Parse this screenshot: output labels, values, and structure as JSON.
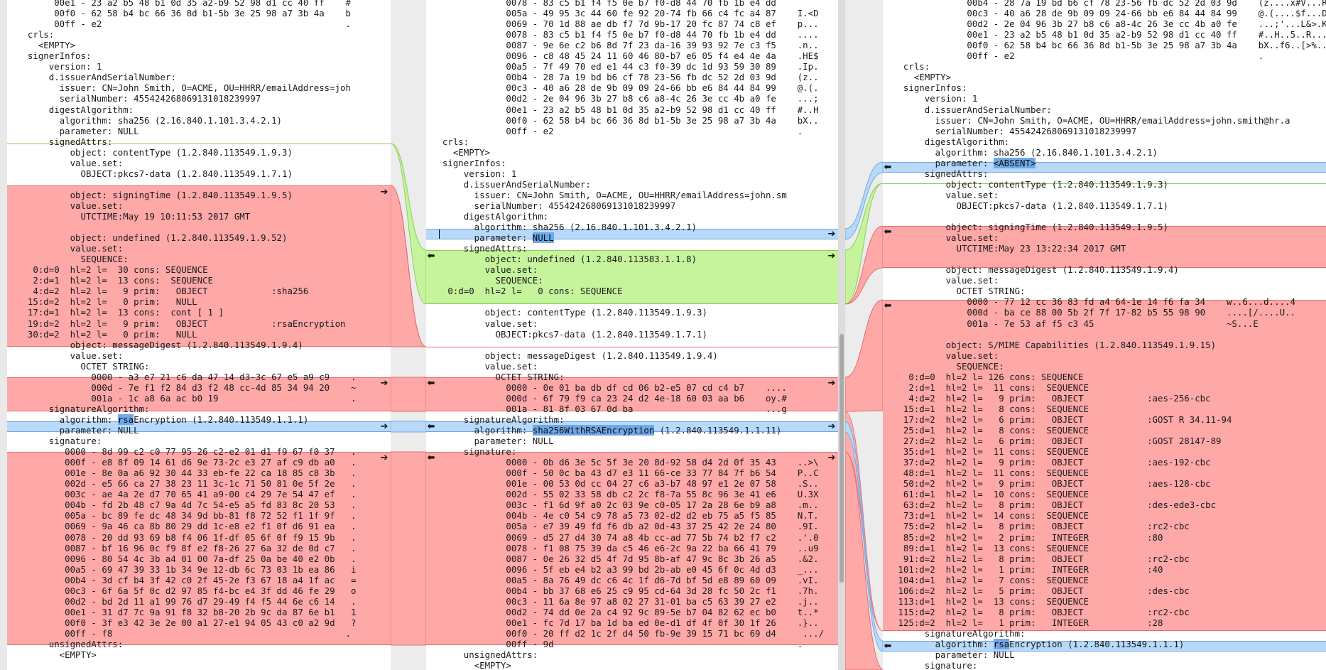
{
  "colors": {
    "deleted": "#ffa8a8",
    "inserted": "#c6f49c",
    "changed": "#b8d9fa",
    "token_highlight": "#6fa8e8"
  },
  "icons": {
    "merge_right": "arrow-right-icon",
    "merge_left": "arrow-left-icon"
  },
  "panes": [
    {
      "lines": [
        "       00e1 - 23 a2 b5 48 b1 0d 35 a2-b9 52 98 d1 cc 40 ff    #",
        "       00f0 - 62 58 b4 bc 66 36 8d b1-5b 3e 25 98 a7 3b 4a    b",
        "       00ff - e2                                              .",
        "  crls:",
        "    <EMPTY>",
        "  signerInfos:",
        "      version: 1",
        "      d.issuerAndSerialNumber:",
        "        issuer: CN=John Smith, O=ACME, OU=HHRR/emailAddress=joh",
        "        serialNumber: 4554242680691310182399​97",
        "      digestAlgorithm:",
        "        algorithm: sha256 (2.16.840.1.101.3.4.2.1)",
        "        parameter: NULL",
        "      signedAttrs:",
        "          object: contentType (1.2.840.113549.1.9.3)",
        "          value.set:",
        "            OBJECT:pkcs7-data (1.2.840.113549.1.7.1)",
        "",
        "          object: signingTime (1.2.840.113549.1.9.5)",
        "          value.set:",
        "            UTCTIME:May 19 10:11:53 2017 GMT",
        "",
        "          object: undefined (1.2.840.113549.1.9.52)",
        "          value.set:",
        "            SEQUENCE:",
        "   0:d=0  hl=2 l=  30 cons: SEQUENCE",
        "   2:d=1  hl=2 l=  13 cons:  SEQUENCE",
        "   4:d=2  hl=2 l=   9 prim:   OBJECT            :sha256",
        "  15:d=2  hl=2 l=   0 prim:   NULL",
        "  17:d=1  hl=2 l=  13 cons:  cont [ 1 ]",
        "  19:d=2  hl=2 l=   9 prim:   OBJECT            :rsaEncryption",
        "  30:d=2  hl=2 l=   0 prim:   NULL",
        "          object: messageDigest (1.2.840.113549.1.9.4)",
        "          value.set:",
        "            OCTET STRING:",
        "              0000 - a3 e7 21 c6 da 47 14 d3-3c 67 e5 a9 c9    .",
        "              000d - 7e f1 f2 84 d3 f2 48 cc-4d 85 34 94 20    ~",
        "              001a - 1c a8 6a ac b0 19                         .",
        "      signatureAlgorithm:",
        "        algorithm: rsaEncryption (1.2.840.113549.1.1.1)",
        "        parameter: NULL",
        "      signature:",
        "         0000 - 8d 99 c2 c0 77 95 26 c2-e2 01 d1 f9 67 f0 37   .",
        "         000f - e8 8f 09 14 61 d6 9e 73-2c e3 27 af c9 db a0   .",
        "         001e - 8e 0a a6 92 30 44 33 eb-fe 22 ca 18 85 c8 3b   .",
        "         002d - e5 66 ca 27 38 23 11 3c-1c 71 50 81 0e 5f 2e   .",
        "         003c - ae 4a 2e d7 70 65 41 a9-00 c4 29 7e 54 47 ef   .",
        "         004b - fd 2b 48 c7 9a 4d 7c 54-e5 a5 fd 83 8c 20 53   .",
        "         005a - bc 89 fe dc 48 34 9d bb-81 f8 72 52 f1 1f 9f   .",
        "         0069 - 9a 46 ca 8b 80 29 dd 1c-e8 e2 f1 0f d6 91 ea   .",
        "         0078 - 20 dd 93 69 b8 f4 06 1f-df 05 6f 0f f9 15 9b   .",
        "         0087 - bf 16 96 0c f9 8f e2 f8-26 27 6a 32 de 0d c7   .",
        "         0096 - 80 54 4c 3b a4 01 00 7a-df 25 0a be 40 e2 0b   .",
        "         00a5 - 69 47 39 33 1b 34 9e 12-db 6c 73 03 1b ea 86   i",
        "         00b4 - 3d cf b4 3f 42 c0 2f 45-2e f3 67 18 a4 1f ac   =",
        "         00c3 - 6f 6a 5f 0c d2 97 85 f4-bc e4 3f dd 46 fe 29   o",
        "         00d2 - bd 2d 11 a1 99 76 d7 29-49 f4 f5 44 6e c6 14   .",
        "         00e1 - 31 d7 7c 9a 91 f8 32 b8-20 2b 9c da 87 6e b1   1",
        "         00f0 - 3f e3 42 3e 2e 00 a1 27-e1 94 05 43 c0 a2 9d   ?",
        "         00ff - f8                                            .",
        "      unsignedAttrs:",
        "        <EMPTY>"
      ]
    },
    {
      "lines": [
        "              0078 - 83 c5 b1 f4 f5 0e b7 f0-d8 44 70 fb 1b e4 dd",
        "              005a - 49 95 3c 44 60 fe 92 20-74 fb 66 c4 fc a4 87    I.<D",
        "              0069 - 70 1d 88 ae db f7 7d 9b-17 20 fc 87 74 c8 ef    p...",
        "              0078 - 83 c5 b1 f4 f5 0e b7 f0-d8 44 70 fb 1b e4 dd    ....",
        "              0087 - 9e 6e c2 b6 8d 7f 23 da-16 39 93 92 7e c3 f5    .n..",
        "              0096 - c8 48 45 24 11 60 46 80-b7 e6 05 f4 e4 4e 4a    .HE$",
        "              00a5 - 7f 49 70 ed e1 44 c3 f0-39 dc 1d 93 59 30 89    .Ip.",
        "              00b4 - 28 7a 19 bd b6 cf 78 23-56 fb dc 52 2d 03 9d    (z..",
        "              00c3 - 40 a6 28 de 9b 09 09 24-66 bb e6 84 44 84 99    @.(.",
        "              00d2 - 2e 04 96 3b 27 b8 c6 a8-4c 26 3e cc 4b a0 fe    ...;",
        "              00e1 - 23 a2 b5 48 b1 0d 35 a2-b9 52 98 d1 cc 40 ff    #..H",
        "              00f0 - 62 58 b4 bc 66 36 8d b1-5b 3e 25 98 a7 3b 4a    bX..",
        "              00ff - e2                                              .",
        "  crls:",
        "    <EMPTY>",
        "  signerInfos:",
        "      version: 1",
        "      d.issuerAndSerialNumber:",
        "        issuer: CN=John Smith, O=ACME, OU=HHRR/emailAddress=john.sm",
        "        serialNumber: 4554242680691310182399​97",
        "      digestAlgorithm:",
        "        algorithm: sha256 (2.16.840.1.101.3.4.2.1)",
        "        parameter: NULL",
        "      signedAttrs:",
        "          object: undefined (1.2.840.113583.1.1.8)",
        "          value.set:",
        "            SEQUENCE:",
        "   0:d=0  hl=2 l=   0 cons: SEQUENCE",
        "",
        "          object: contentType (1.2.840.113549.1.9.3)",
        "          value.set:",
        "            OBJECT:pkcs7-data (1.2.840.113549.1.7.1)",
        "",
        "          object: messageDigest (1.2.840.113549.1.9.4)",
        "          value.set:",
        "            OCTET STRING:",
        "              0000 - 0e 01 ba db df cd 06 b2-e5 07 cd c4 b7    ....",
        "              000d - 6f 79 f9 ca 23 24 d2 4e-18 60 03 aa b6    oy.#",
        "              001a - 81 8f 03 67 0d ba                         ...g",
        "      signatureAlgorithm:",
        "        algorithm: sha256WithRSAEncryption (1.2.840.113549.1.1.11)",
        "        parameter: NULL",
        "      signature:",
        "              0000 - 0b d6 3e 5c 5f 3e 20 8d-92 58 d4 2d 0f 35 43    ..>\\",
        "              000f - 50 0c ba 43 d7 e3 11 66-ce 33 77 84 7f b6 54    P..C",
        "              001e - 00 53 0d cc 04 27 c6 a3-b7 48 97 e1 2e 07 58    .S..",
        "              002d - 55 02 33 58 db c2 2c f8-7a 55 8c 96 3e 41 e6    U.3X",
        "              003c - f1 6d 9f a0 2c 03 9e c0-05 17 2a 28 6e b9 a8    .m..",
        "              004b - 4e c0 54 c9 78 a5 73 02-d2 d2 eb 75 a5 f5 85    N.T.",
        "              005a - e7 39 49 fd f6 db a2 0d-43 37 25 42 2e 24 80    .9I.",
        "              0069 - d5 27 d4 30 74 a8 4b cc-ad 77 5b 74 b2 f7 c2    .'.0",
        "              0078 - f1 08 75 39 da c5 46 e6-2c 9a 22 ba 66 41 79    ..u9",
        "              0087 - 0e 26 32 d5 4f 7d 95 8b-af 47 9c 8c 3b 26 a5    .&2.",
        "              0096 - 5f eb e4 b2 a3 99 bd 2b-ab e0 45 6f 0c 4d d3    _...",
        "              00a5 - 8a 76 49 dc c6 4c 1f d6-7d bf 5d e8 89 60 09    .vI.",
        "              00b4 - bb 37 68 e6 25 c9 95 cd-64 3d 28 fc 50 2c f1    .7h.",
        "              00c3 - 11 6a 8e 97 a8 02 27 31-01 ba c5 63 39 27 e2    .j..",
        "              00d2 - 74 dd 0e 2a c4 92 9c 89-5e b7 04 82 62 ec b0    t..*",
        "              00e1 - fc 7d 17 ba 1d ba ed 0e-d1 df 4f 0f 30 1f 26    .}..",
        "              00f0 - 20 ff d2 1c 2f d4 50 fb-9e 39 15 71 bc 69 d4     .../",
        "              00ff - 9d                                              .",
        "      unsignedAttrs:",
        "        <EMPTY>"
      ]
    },
    {
      "lines": [
        "              00b4 - 28 7a 19 bd b6 cf 78 23-56 fb dc 52 2d 03 9d    (z....x#V...R",
        "              00c3 - 40 a6 28 de 9b 09 09 24-66 bb e6 84 44 84 99    @.(....$f...D",
        "              00d2 - 2e 04 96 3b 27 b8 c6 a8-4c 26 3e cc 4b a0 fe    ...;'...L&>.K",
        "              00e1 - 23 a2 b5 48 b1 0d 35 a2-b9 52 98 d1 cc 40 ff    #..H..5..R...",
        "              00f0 - 62 58 b4 bc 66 36 8d b1-5b 3e 25 98 a7 3b 4a    bX..f6..[>%..",
        "              00ff - e2                                              .",
        "  crls:",
        "    <EMPTY>",
        "  signerInfos:",
        "      version: 1",
        "      d.issuerAndSerialNumber:",
        "        issuer: CN=John Smith, O=ACME, OU=HHRR/emailAddress=john.smith@hr.a",
        "        serialNumber: 4554242680691310182399​97",
        "      digestAlgorithm:",
        "        algorithm: sha256 (2.16.840.1.101.3.4.2.1)",
        "        parameter: <ABSENT>",
        "      signedAttrs:",
        "          object: contentType (1.2.840.113549.1.9.3)",
        "          value.set:",
        "            OBJECT:pkcs7-data (1.2.840.113549.1.7.1)",
        "",
        "          object: signingTime (1.2.840.113549.1.9.5)",
        "          value.set:",
        "            UTCTIME:May 23 13:22:34 2017 GMT",
        "",
        "          object: messageDigest (1.2.840.113549.1.9.4)",
        "          value.set:",
        "            OCTET STRING:",
        "              0000 - 77 12 cc 36 83 fd a4 64-1e 14 f6 fa 34    w..6...d....4",
        "              000d - ba ce 88 00 5b 2f 7f 17-82 b5 55 98 90    ....[/....U..",
        "              001a - 7e 53 af f5 c3 45                         ~S...E",
        "",
        "          object: S/MIME Capabilities (1.2.840.113549.1.9.15)",
        "          value.set:",
        "            SEQUENCE:",
        "   0:d=0  hl=2 l= 126 cons: SEQUENCE",
        "   2:d=1  hl=2 l=  11 cons:  SEQUENCE",
        "   4:d=2  hl=2 l=   9 prim:   OBJECT            :aes-256-cbc",
        "  15:d=1  hl=2 l=   8 cons:  SEQUENCE",
        "  17:d=2  hl=2 l=   6 prim:   OBJECT            :GOST R 34.11-94",
        "  25:d=1  hl=2 l=   8 cons:  SEQUENCE",
        "  27:d=2  hl=2 l=   6 prim:   OBJECT            :GOST 28147-89",
        "  35:d=1  hl=2 l=  11 cons:  SEQUENCE",
        "  37:d=2  hl=2 l=   9 prim:   OBJECT            :aes-192-cbc",
        "  48:d=1  hl=2 l=  11 cons:  SEQUENCE",
        "  50:d=2  hl=2 l=   9 prim:   OBJECT            :aes-128-cbc",
        "  61:d=1  hl=2 l=  10 cons:  SEQUENCE",
        "  63:d=2  hl=2 l=   8 prim:   OBJECT            :des-ede3-cbc",
        "  73:d=1  hl=2 l=  14 cons:  SEQUENCE",
        "  75:d=2  hl=2 l=   8 prim:   OBJECT            :rc2-cbc",
        "  85:d=2  hl=2 l=   2 prim:   INTEGER           :80",
        "  89:d=1  hl=2 l=  13 cons:  SEQUENCE",
        "  91:d=2  hl=2 l=   8 prim:   OBJECT            :rc2-cbc",
        " 101:d=2  hl=2 l=   1 prim:   INTEGER           :40",
        " 104:d=1  hl=2 l=   7 cons:  SEQUENCE",
        " 106:d=2  hl=2 l=   5 prim:   OBJECT            :des-cbc",
        " 113:d=1  hl=2 l=  13 cons:  SEQUENCE",
        " 115:d=2  hl=2 l=   8 prim:   OBJECT            :rc2-cbc",
        " 125:d=2  hl=2 l=   1 prim:   INTEGER           :28",
        "      signatureAlgorithm:",
        "        algorithm: rsaEncryption (1.2.840.113549.1.1.1)",
        "        parameter: NULL",
        "      signature:"
      ]
    }
  ]
}
